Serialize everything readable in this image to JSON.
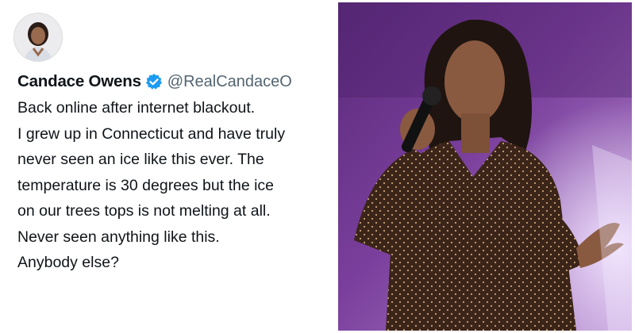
{
  "tweet": {
    "author_name": "Candace Owens",
    "handle": "@RealCandaceO",
    "verified": true,
    "accent_color": "#1d9bf0",
    "lines": [
      "Back online after internet blackout.",
      "I grew up in Connecticut and have truly",
      "never seen an ice like this ever. The",
      "temperature is 30 degrees but the ice",
      "on our trees tops is not melting at all.",
      "Never seen anything like this.",
      "Anybody else?"
    ]
  },
  "icons": {
    "verified": "verified-badge-icon"
  }
}
